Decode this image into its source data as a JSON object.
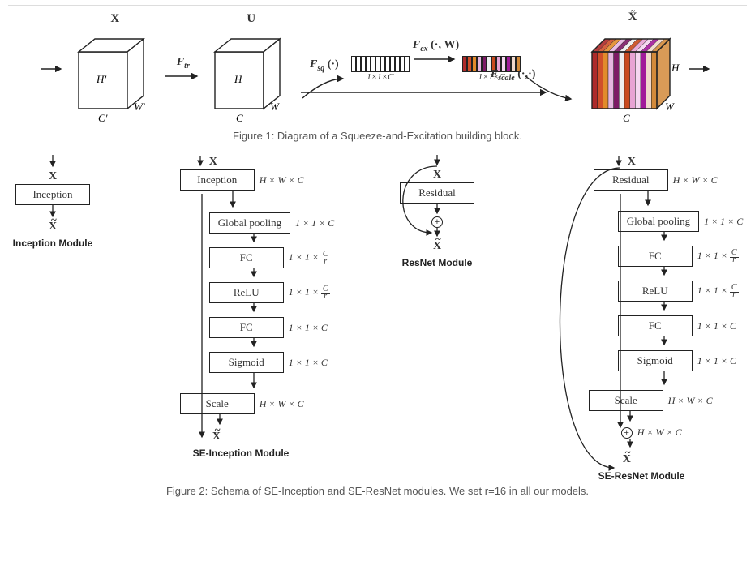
{
  "fig1": {
    "caption": "Figure 1: Diagram of a Squeeze-and-Excitation building block.",
    "symbols": {
      "X": "X",
      "U": "U",
      "Xt": "X̃",
      "Ftr": "Ftr",
      "Fsq": "Fsq (·)",
      "Fex": "Fex (·, W)",
      "Fscale": "Fscale (·,·)"
    },
    "dims": {
      "Hp": "H'",
      "Wp": "W'",
      "Cp": "C'",
      "H": "H",
      "W": "W",
      "C": "C",
      "vec": "1×1×C"
    },
    "slice_colors": [
      "#ad2a2a",
      "#d04f2a",
      "#e28b2b",
      "#e6b6e0",
      "#7d1a65",
      "#efefef",
      "#c94a1e",
      "#e8a3d4",
      "#f5d6f0",
      "#a11a9a",
      "#f0d8cc",
      "#d38a3a"
    ]
  },
  "fig2": {
    "caption": "Figure 2: Schema of SE-Inception and SE-ResNet modules. We set r=16 in all our models.",
    "labels": {
      "X": "X",
      "Xt": "X̃",
      "inception": "Inception",
      "residual": "Residual",
      "gp": "Global pooling",
      "fc": "FC",
      "relu": "ReLU",
      "sigmoid": "Sigmoid",
      "scale": "Scale",
      "inc_mod": "Inception Module",
      "se_inc_mod": "SE-Inception Module",
      "res_mod": "ResNet Module",
      "se_res_mod": "SE-ResNet Module"
    },
    "dims": {
      "hwc": "H × W × C",
      "11c": "1 × 1 × C",
      "11cr": "1 × 1 × C/r"
    }
  }
}
